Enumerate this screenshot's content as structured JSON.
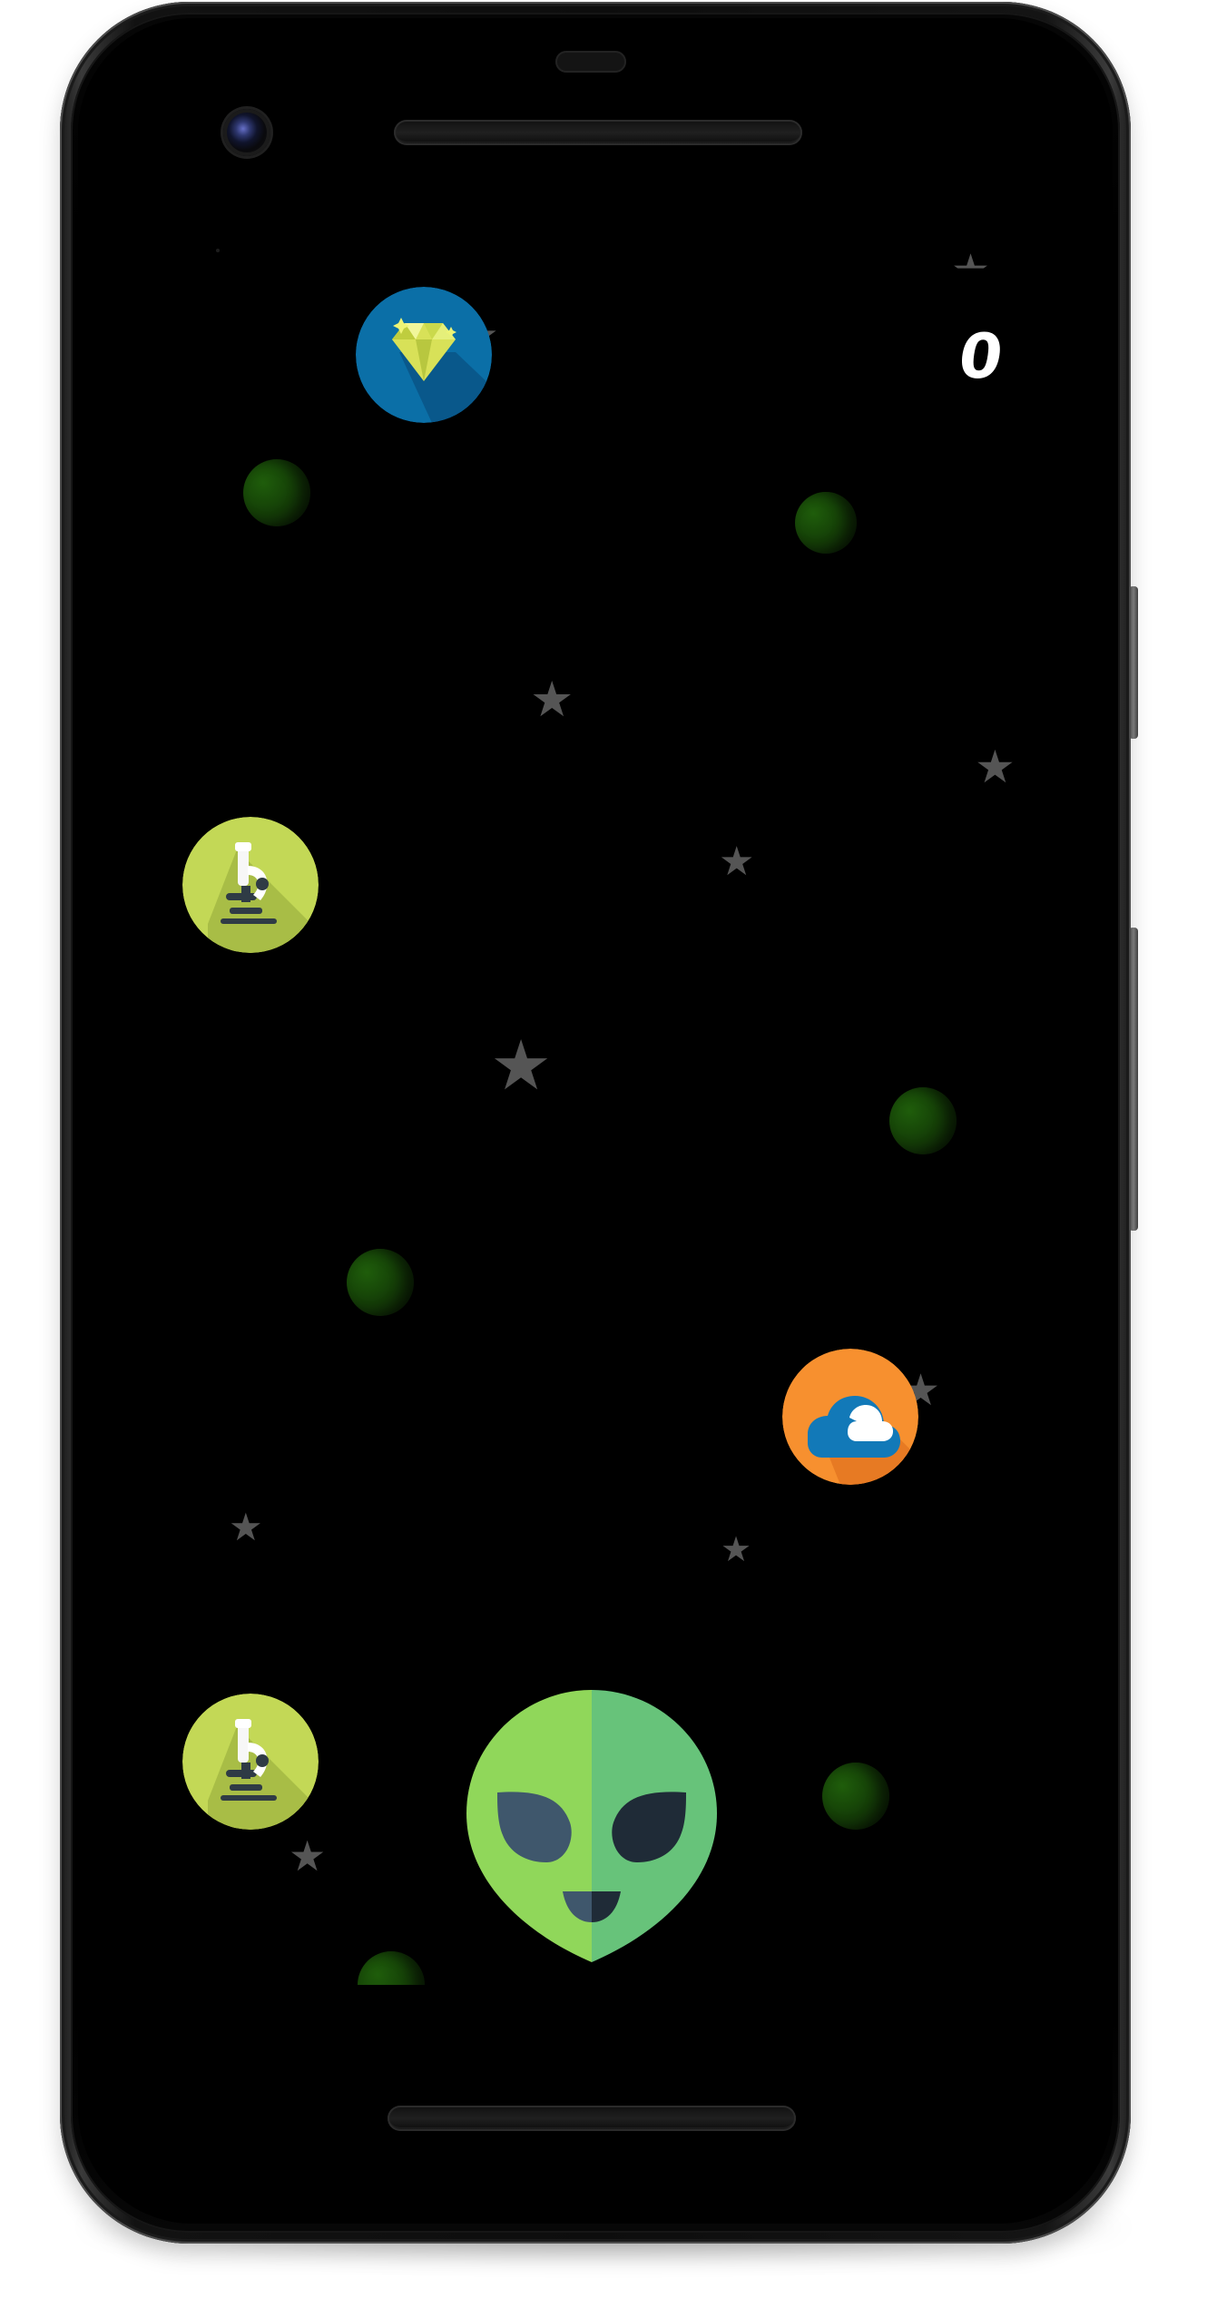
{
  "game": {
    "score": "0",
    "player": {
      "icon": "alien-head-icon",
      "colors": [
        "#90D75A",
        "#67C37A",
        "#3F576C",
        "#1F2B37"
      ]
    },
    "pickups": [
      {
        "icon": "diamond-icon",
        "colors": [
          "#0B6FA7",
          "#0A5E90",
          "#D9E65A"
        ]
      },
      {
        "icon": "microscope-icon",
        "colors": [
          "#C3D856",
          "#A7B946",
          "#FFFFFF",
          "#2E3B45"
        ]
      },
      {
        "icon": "cloud-icon",
        "colors": [
          "#F7902F",
          "#E77A23",
          "#1279B8",
          "#FFFFFF"
        ]
      },
      {
        "icon": "microscope-icon",
        "colors": [
          "#C3D856",
          "#A7B946",
          "#FFFFFF",
          "#2E3B45"
        ]
      }
    ],
    "theme": {
      "background": "#000000",
      "star": "#555555",
      "green_orb": "#174708"
    }
  }
}
